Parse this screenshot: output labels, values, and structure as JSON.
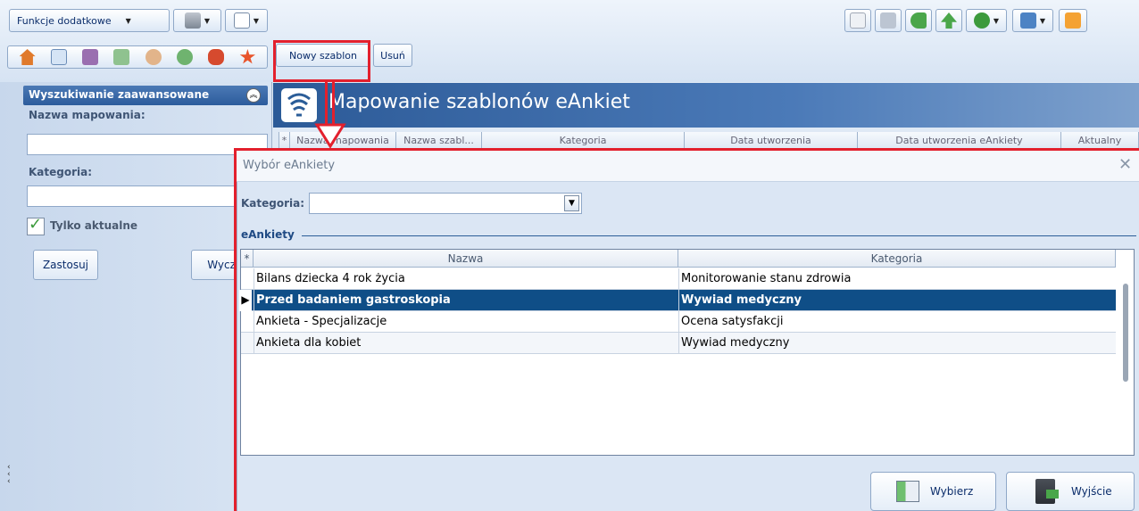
{
  "toolbar": {
    "funkcje_label": "Funkcje dodatkowe",
    "new_template_label": "Nowy szablon",
    "delete_label": "Usuń"
  },
  "search_panel": {
    "title": "Wyszukiwanie zaawansowane",
    "mapping_name_label": "Nazwa mapowania:",
    "mapping_name_value": "",
    "category_label": "Kategoria:",
    "category_value": "",
    "only_current_label": "Tylko aktualne",
    "only_current_checked": true,
    "apply_label": "Zastosuj",
    "clear_label": "Wyczy"
  },
  "main": {
    "title": "Mapowanie szablonów eAnkiet",
    "columns": [
      "Nazwa mapowania",
      "Nazwa szabl...",
      "Kategoria",
      "Data utworzenia",
      "Data utworzenia eAnkiety",
      "Aktualny"
    ]
  },
  "dialog": {
    "title": "Wybór eAnkiety",
    "category_label": "Kategoria:",
    "category_value": "",
    "group_label": "eAnkiety",
    "columns": [
      "Nazwa",
      "Kategoria"
    ],
    "rows": [
      {
        "name": "Bilans dziecka 4 rok życia",
        "category": "Monitorowanie stanu zdrowia"
      },
      {
        "name": "Przed badaniem gastroskopia",
        "category": "Wywiad medyczny"
      },
      {
        "name": "Ankieta - Specjalizacje",
        "category": "Ocena satysfakcji"
      },
      {
        "name": "Ankieta dla kobiet",
        "category": "Wywiad medyczny"
      }
    ],
    "selected_row": 1,
    "select_label": "Wybierz",
    "exit_label": "Wyjście"
  },
  "colors": {
    "accent": "#0f4e87",
    "highlight": "#e3202d"
  }
}
